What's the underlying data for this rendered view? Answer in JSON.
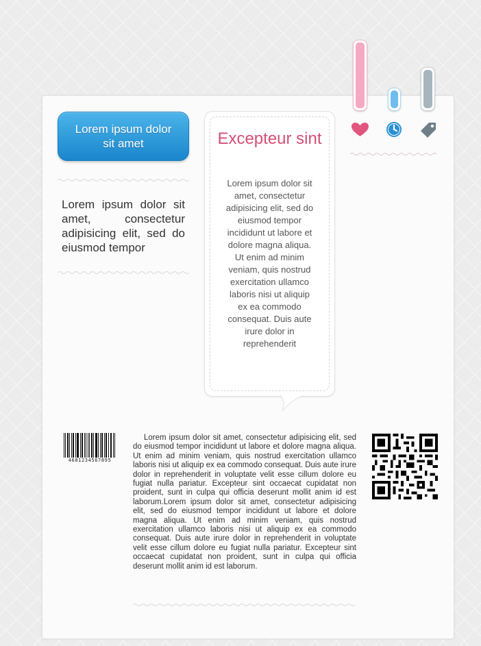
{
  "header": {
    "button_label": "Lorem ipsum dolor sit amet"
  },
  "intro": {
    "text": "Lorem ipsum dolor sit amet, consectetur adipisicing elit, sed do eiusmod tempor"
  },
  "bubble": {
    "title": "Excepteur sint",
    "text": "Lorem ipsum dolor sit amet, consectetur adipisicing elit, sed do eiusmod tempor incididunt ut labore et dolore magna aliqua. Ut enim ad minim veniam, quis nostrud exercitation ullamco laboris nisi ut aliquip ex ea commodo consequat. Duis aute irure dolor in reprehenderit"
  },
  "tabs": [
    {
      "icon": "heart-icon",
      "color": "#e2557e",
      "pin_color": "#f6a9c4"
    },
    {
      "icon": "clock-icon",
      "color": "#2a8fd3",
      "pin_color": "#7cc3f0"
    },
    {
      "icon": "tag-icon",
      "color": "#6f7f89",
      "pin_color": "#b7c2c9"
    }
  ],
  "footer": {
    "barcode_digits": "4681234567895",
    "text": "Lorem ipsum dolor sit amet, consectetur adipisicing elit, sed do eiusmod tempor incididunt ut labore et dolore magna aliqua. Ut enim ad minim veniam, quis nostrud exercitation ullamco laboris nisi ut aliquip ex ea commodo consequat. Duis aute irure dolor in reprehenderit in voluptate velit esse cillum dolore eu fugiat nulla pariatur. Excepteur sint occaecat cupidatat non proident, sunt in culpa qui officia deserunt mollit anim id est laborum.Lorem ipsum dolor sit amet, consectetur adipisicing elit, sed do eiusmod tempor incididunt ut labore et dolore magna aliqua. Ut enim ad minim veniam, quis nostrud exercitation ullamco laboris nisi ut aliquip ex ea commodo consequat. Duis aute irure dolor in reprehenderit in voluptate velit esse cillum dolore eu fugiat nulla pariatur. Excepteur sint occaecat cupidatat non proident, sunt in culpa qui officia deserunt mollit anim id est laborum."
  },
  "colors": {
    "accent_blue": "#1a86cc",
    "title_pink": "#d34f78"
  }
}
